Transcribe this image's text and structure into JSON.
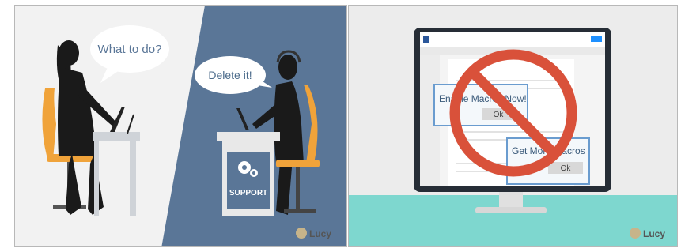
{
  "left_scene": {
    "bubble_question": "What to do?",
    "bubble_answer": "Delete it!",
    "desk_sign": "SUPPORT",
    "brand": "Lucy"
  },
  "right_scene": {
    "dialog1_title": "Enable Macros Now!",
    "dialog1_button": "Ok",
    "dialog2_title": "Get More Macros",
    "dialog2_button": "Ok",
    "brand": "Lucy",
    "icons": [
      "word-doc-icon",
      "prohibited-sign-icon",
      "lucy-mascot-icon"
    ],
    "colors": {
      "blue_wall": "#5a7697",
      "prohibit_red": "#d9513a",
      "chair_orange": "#f0a33a",
      "desk_teal": "#7ed7cf"
    }
  }
}
